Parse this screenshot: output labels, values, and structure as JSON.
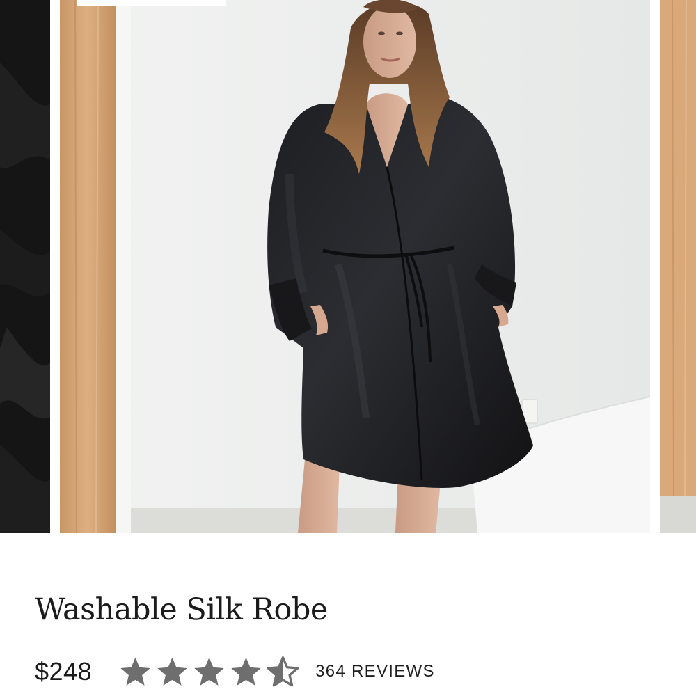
{
  "product": {
    "title": "Washable Silk Robe",
    "price": "$248",
    "rating": 4.5,
    "rating_max": 5,
    "reviews_label": "364 REVIEWS"
  },
  "carousel": {
    "slides": [
      {
        "kind": "photo",
        "description_icon": "previous-product-image"
      },
      {
        "kind": "photo",
        "description_icon": "product-image"
      },
      {
        "kind": "photo",
        "description_icon": "next-product-image"
      }
    ]
  },
  "colors": {
    "text": "#1b1b1b",
    "star": "#6e6e6e",
    "robe": "#141416",
    "wall": "#eceeed",
    "wood": "#d9a97a"
  },
  "icons": {
    "star_full": "star-filled-icon",
    "star_half": "star-half-icon"
  }
}
